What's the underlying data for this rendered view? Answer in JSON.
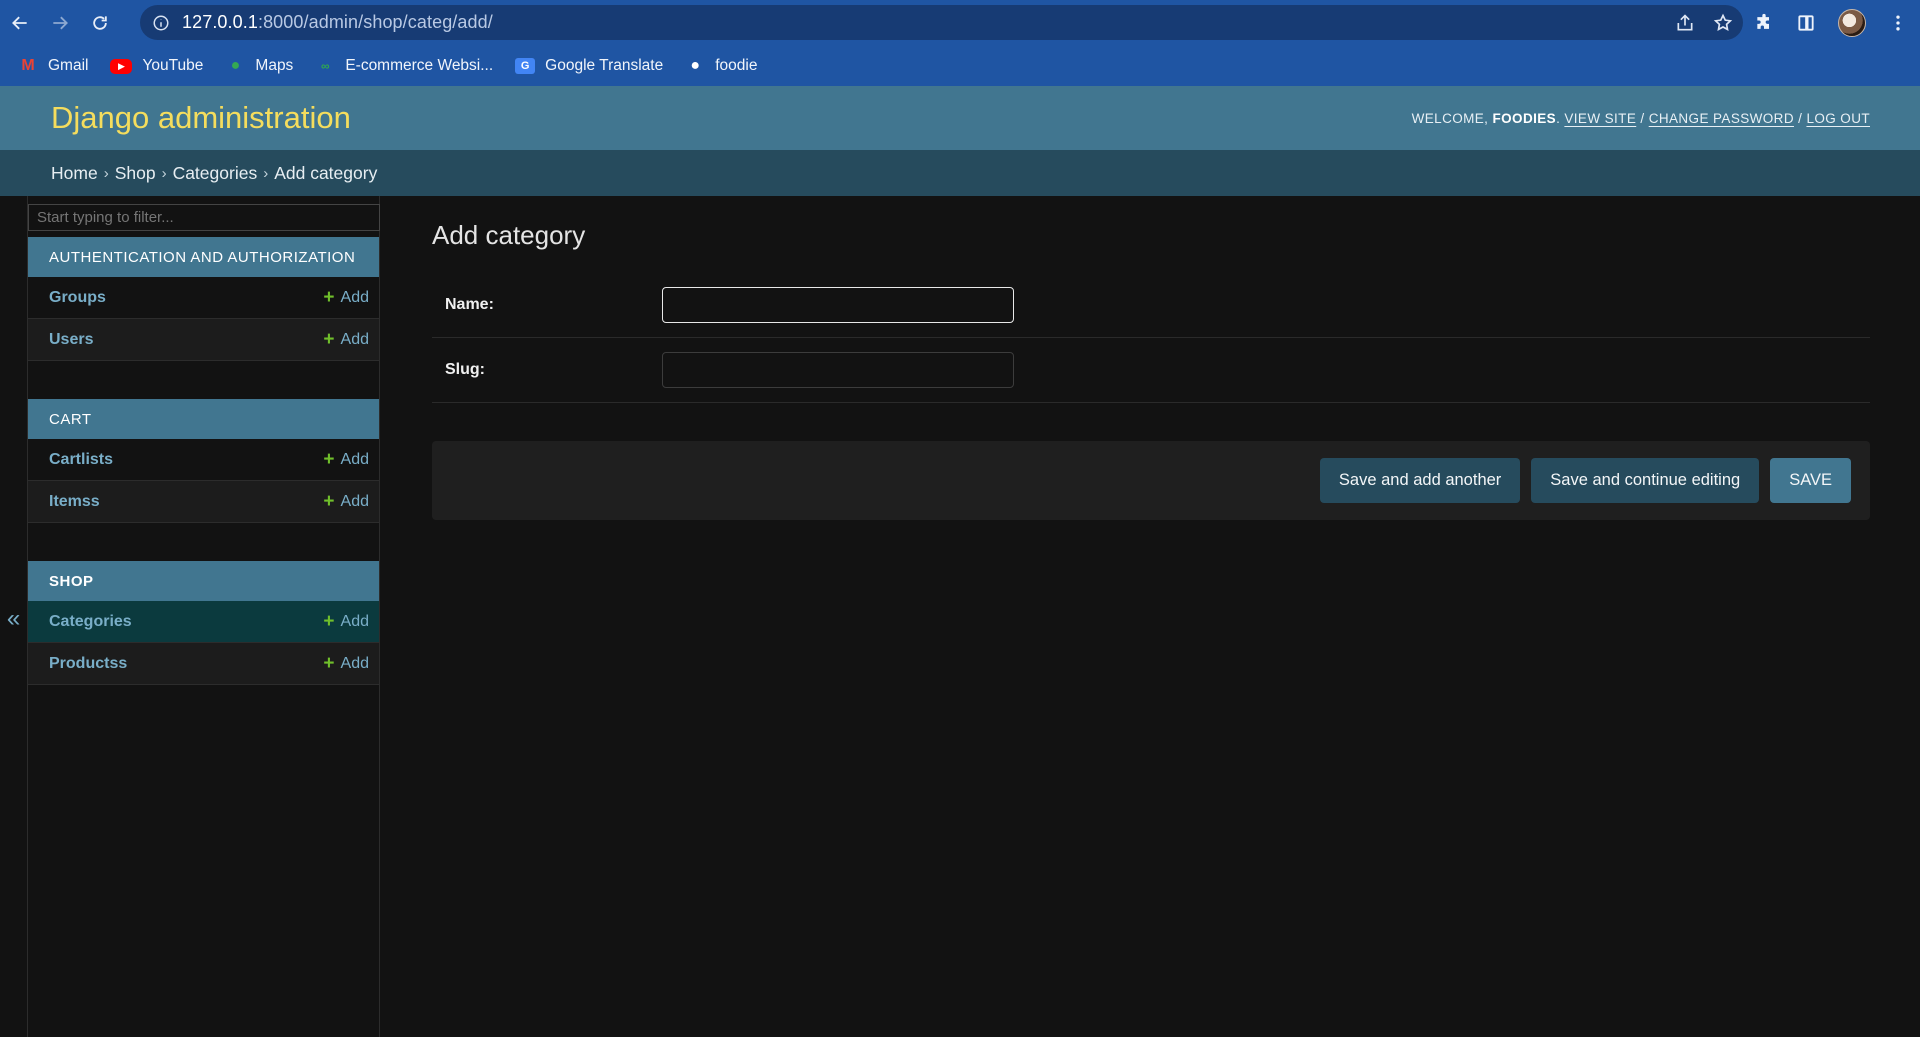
{
  "browser": {
    "url_host": "127.0.0.1",
    "url_rest": ":8000/admin/shop/categ/add/",
    "bookmarks": [
      {
        "label": "Gmail",
        "icon": "gmail-icon"
      },
      {
        "label": "YouTube",
        "icon": "youtube-icon"
      },
      {
        "label": "Maps",
        "icon": "maps-icon"
      },
      {
        "label": "E-commerce Websi...",
        "icon": "ecommerce-icon"
      },
      {
        "label": "Google Translate",
        "icon": "google-translate-icon"
      },
      {
        "label": "foodie",
        "icon": "globe-icon"
      }
    ]
  },
  "header": {
    "branding": "Django administration",
    "welcome": "Welcome,",
    "username": "foodies",
    "view_site": "View site",
    "change_password": "Change password",
    "log_out": "Log out",
    "sep": "/"
  },
  "breadcrumbs": [
    "Home",
    "Shop",
    "Categories",
    "Add category"
  ],
  "breadcrumb_sep": "›",
  "sidebar": {
    "filter_placeholder": "Start typing to filter...",
    "toggle": "«",
    "add_label": "Add",
    "modules": [
      {
        "caption": "Authentication and Authorization",
        "models": [
          "Groups",
          "Users"
        ]
      },
      {
        "caption": "Cart",
        "models": [
          "Cartlists",
          "Itemss"
        ]
      },
      {
        "caption": "Shop",
        "models": [
          "Categories",
          "Productss"
        ]
      }
    ]
  },
  "form": {
    "title": "Add category",
    "fields": [
      {
        "label": "Name:",
        "value": ""
      },
      {
        "label": "Slug:",
        "value": ""
      }
    ],
    "buttons": {
      "save_add_another": "Save and add another",
      "save_continue": "Save and continue editing",
      "save": "Save"
    }
  },
  "colors": {
    "header": "#417690",
    "breadcrumbs": "#264b5d",
    "branding": "#f5dd5d",
    "link": "#79aec8",
    "add_plus": "#70bf2b"
  }
}
